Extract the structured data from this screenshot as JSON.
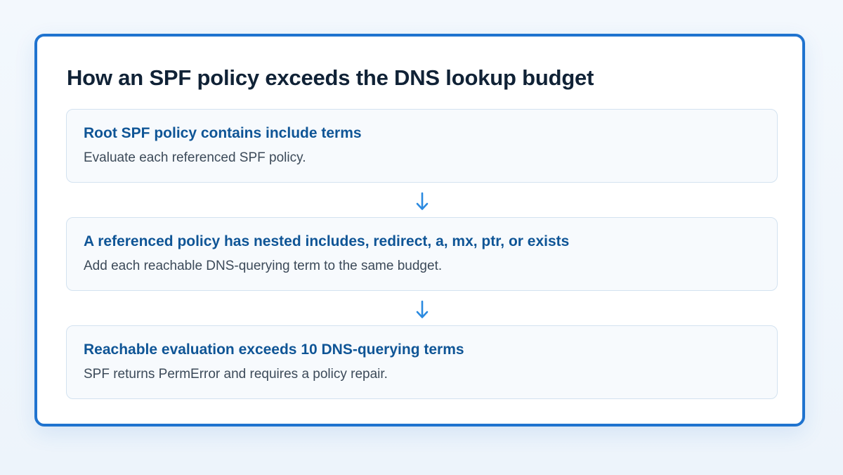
{
  "diagram": {
    "title": "How an SPF policy exceeds the DNS lookup budget",
    "steps": [
      {
        "title": "Root SPF policy contains include terms",
        "description": "Evaluate each referenced SPF policy."
      },
      {
        "title": "A referenced policy has nested includes, redirect, a, mx, ptr, or exists",
        "description": "Add each reachable DNS-querying term to the same budget."
      },
      {
        "title": "Reachable evaluation exceeds 10 DNS-querying terms",
        "description": "SPF returns PermError and requires a policy repair."
      }
    ],
    "colors": {
      "frame_border": "#1f73cf",
      "step_title": "#0f5596",
      "step_text": "#3c4a59",
      "arrow": "#2b8ae0",
      "heading": "#102236"
    },
    "connector_icon": "arrow-down-icon"
  }
}
